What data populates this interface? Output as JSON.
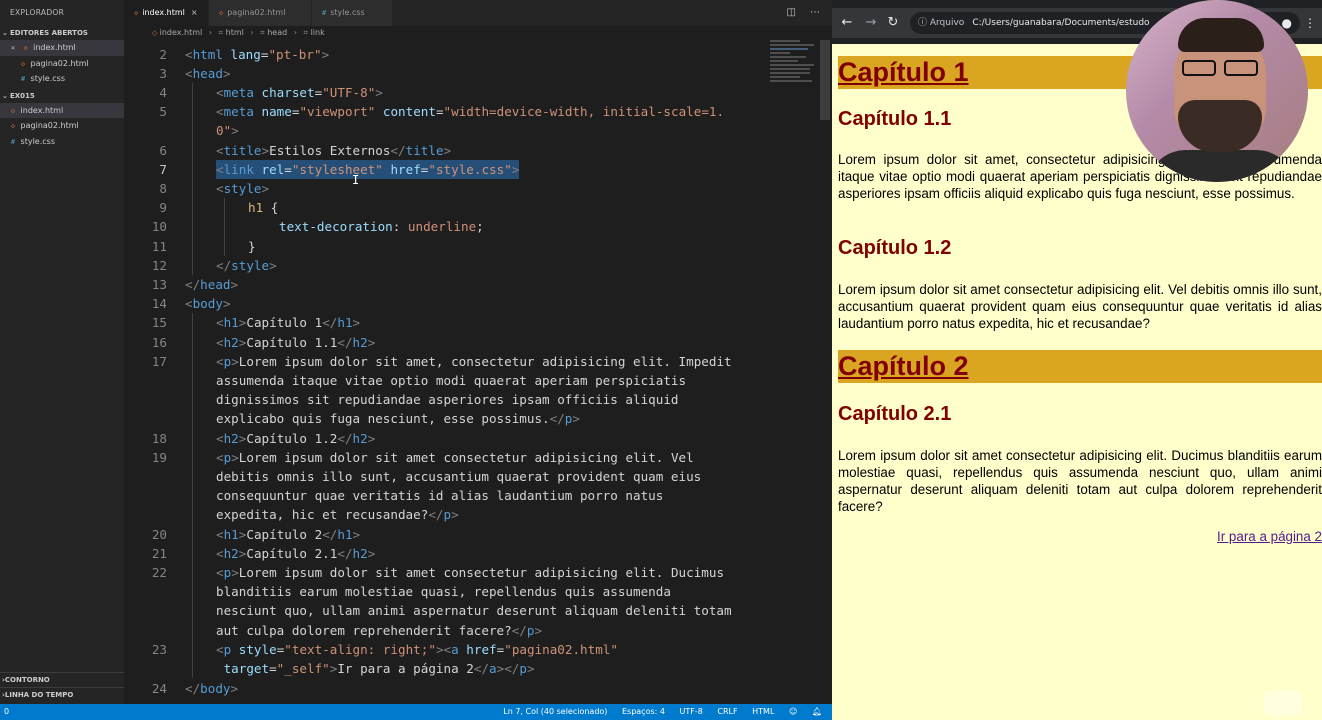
{
  "explorer": {
    "title": "EXPLORADOR",
    "open_editors": "EDITORES ABERTOS",
    "open_files": [
      {
        "name": "index.html",
        "type": "html",
        "close": "×"
      },
      {
        "name": "pagina02.html",
        "type": "html"
      },
      {
        "name": "style.css",
        "type": "css"
      }
    ],
    "folder": "EX015",
    "folder_files": [
      {
        "name": "index.html",
        "type": "html"
      },
      {
        "name": "pagina02.html",
        "type": "html"
      },
      {
        "name": "style.css",
        "type": "css"
      }
    ],
    "outline": "CONTORNO",
    "timeline": "LINHA DO TEMPO"
  },
  "tabs": [
    {
      "label": "index.html",
      "type": "html",
      "active": true
    },
    {
      "label": "pagina02.html",
      "type": "html"
    },
    {
      "label": "style.css",
      "type": "css"
    }
  ],
  "breadcrumb": [
    "index.html",
    "html",
    "head",
    "link"
  ],
  "line_numbers": [
    "2",
    "3",
    "4",
    "5",
    "6",
    "7",
    "8",
    "9",
    "10",
    "11",
    "12",
    "13",
    "14",
    "15",
    "16",
    "17",
    "18",
    "19",
    "20",
    "21",
    "22",
    "23",
    "24"
  ],
  "code": {
    "l2": [
      "<",
      "html",
      " lang",
      "=",
      "\"pt-br\"",
      ">"
    ],
    "l3": [
      "<",
      "head",
      ">"
    ],
    "l4": [
      "<",
      "meta",
      " charset",
      "=",
      "\"UTF-8\"",
      ">"
    ],
    "l5a": [
      "<",
      "meta",
      " name",
      "=",
      "\"viewport\"",
      " content",
      "=",
      "\"width=device-width, initial-scale=1."
    ],
    "l5b": [
      "0\"",
      ">"
    ],
    "l6": [
      "<",
      "title",
      ">",
      "Estilos Externos",
      "</",
      "title",
      ">"
    ],
    "l7": [
      "<",
      "link",
      " rel",
      "=",
      "\"stylesheet\"",
      " href",
      "=",
      "\"style.css\"",
      ">"
    ],
    "l8": [
      "<",
      "style",
      ">"
    ],
    "l9": [
      "h1",
      " {"
    ],
    "l10": [
      "text-decoration",
      ": ",
      "underline",
      ";"
    ],
    "l11": [
      "}"
    ],
    "l12": [
      "</",
      "style",
      ">"
    ],
    "l13": [
      "</",
      "head",
      ">"
    ],
    "l14": [
      "<",
      "body",
      ">"
    ],
    "l15": [
      "<",
      "h1",
      ">",
      "Capítulo 1",
      "</",
      "h1",
      ">"
    ],
    "l16": [
      "<",
      "h2",
      ">",
      "Capítulo 1.1",
      "</",
      "h2",
      ">"
    ],
    "l17a": [
      "<",
      "p",
      ">",
      "Lorem ipsum dolor sit amet, consectetur adipisicing elit. Impedit"
    ],
    "l17b": "assumenda itaque vitae optio modi quaerat aperiam perspiciatis",
    "l17c": "dignissimos sit repudiandae asperiores ipsam officiis aliquid",
    "l17d": [
      "explicabo quis fuga nesciunt, esse possimus.",
      "</",
      "p",
      ">"
    ],
    "l18": [
      "<",
      "h2",
      ">",
      "Capítulo 1.2",
      "</",
      "h2",
      ">"
    ],
    "l19a": [
      "<",
      "p",
      ">",
      "Lorem ipsum dolor sit amet consectetur adipisicing elit. Vel"
    ],
    "l19b": "debitis omnis illo sunt, accusantium quaerat provident quam eius",
    "l19c": "consequuntur quae veritatis id alias laudantium porro natus",
    "l19d": [
      "expedita, hic et recusandae?",
      "</",
      "p",
      ">"
    ],
    "l20": [
      "<",
      "h1",
      ">",
      "Capítulo 2",
      "</",
      "h1",
      ">"
    ],
    "l21": [
      "<",
      "h2",
      ">",
      "Capítulo 2.1",
      "</",
      "h2",
      ">"
    ],
    "l22a": [
      "<",
      "p",
      ">",
      "Lorem ipsum dolor sit amet consectetur adipisicing elit. Ducimus"
    ],
    "l22b": "blanditiis earum molestiae quasi, repellendus quis assumenda",
    "l22c": "nesciunt quo, ullam animi aspernatur deserunt aliquam deleniti totam",
    "l22d": [
      "aut culpa dolorem reprehenderit facere?",
      "</",
      "p",
      ">"
    ],
    "l23a": [
      "<",
      "p",
      " style",
      "=",
      "\"text-align: right;\"",
      ">",
      "<",
      "a",
      " href",
      "=",
      "\"pagina02.html\""
    ],
    "l23b": [
      " target",
      "=",
      "\"_self\"",
      ">",
      "Ir para a página 2",
      "</",
      "a",
      ">",
      "</",
      "p",
      ">"
    ],
    "l24": [
      "</",
      "body",
      ">"
    ]
  },
  "statusbar": {
    "left": "0",
    "position": "Ln 7, Col (40 selecionado)",
    "spaces": "Espaços: 4",
    "encoding": "UTF-8",
    "eol": "CRLF",
    "language": "HTML"
  },
  "browser": {
    "security": "ⓘ Arquivo",
    "url": "C:/Users/guanabara/Documents/estudo",
    "page": {
      "h1_1": "Capítulo 1",
      "h2_11": "Capítulo 1.1",
      "p1": "Lorem ipsum dolor sit amet, consectetur adipisicing elit. Impedit assumenda itaque vitae optio modi quaerat aperiam perspiciatis dignissimos sit repudiandae asperiores ipsam officiis aliquid explicabo quis fuga nesciunt, esse possimus.",
      "h2_12": "Capítulo 1.2",
      "p2": "Lorem ipsum dolor sit amet consectetur adipisicing elit. Vel debitis omnis illo sunt, accusantium quaerat provident quam eius consequuntur quae veritatis id alias laudantium porro natus expedita, hic et recusandae?",
      "h1_2": "Capítulo 2",
      "h2_21": "Capítulo 2.1",
      "p3": "Lorem ipsum dolor sit amet consectetur adipisicing elit. Ducimus blanditiis earum molestiae quasi, repellendus quis assumenda nesciunt quo, ullam animi aspernatur deserunt aliquam deleniti totam aut culpa dolorem reprehenderit facere?",
      "link": "Ir para a página 2"
    }
  },
  "colors": {
    "editor_bg": "#1e1e1e",
    "status_bar": "#007acc",
    "page_bg": "#ffffcc",
    "h1_bg": "#daa520",
    "heading": "#800000"
  },
  "icons": [
    "close-icon",
    "split-editor-icon",
    "more-icon",
    "back-icon",
    "forward-icon",
    "reload-icon",
    "info-icon",
    "profile-icon",
    "menu-icon"
  ]
}
